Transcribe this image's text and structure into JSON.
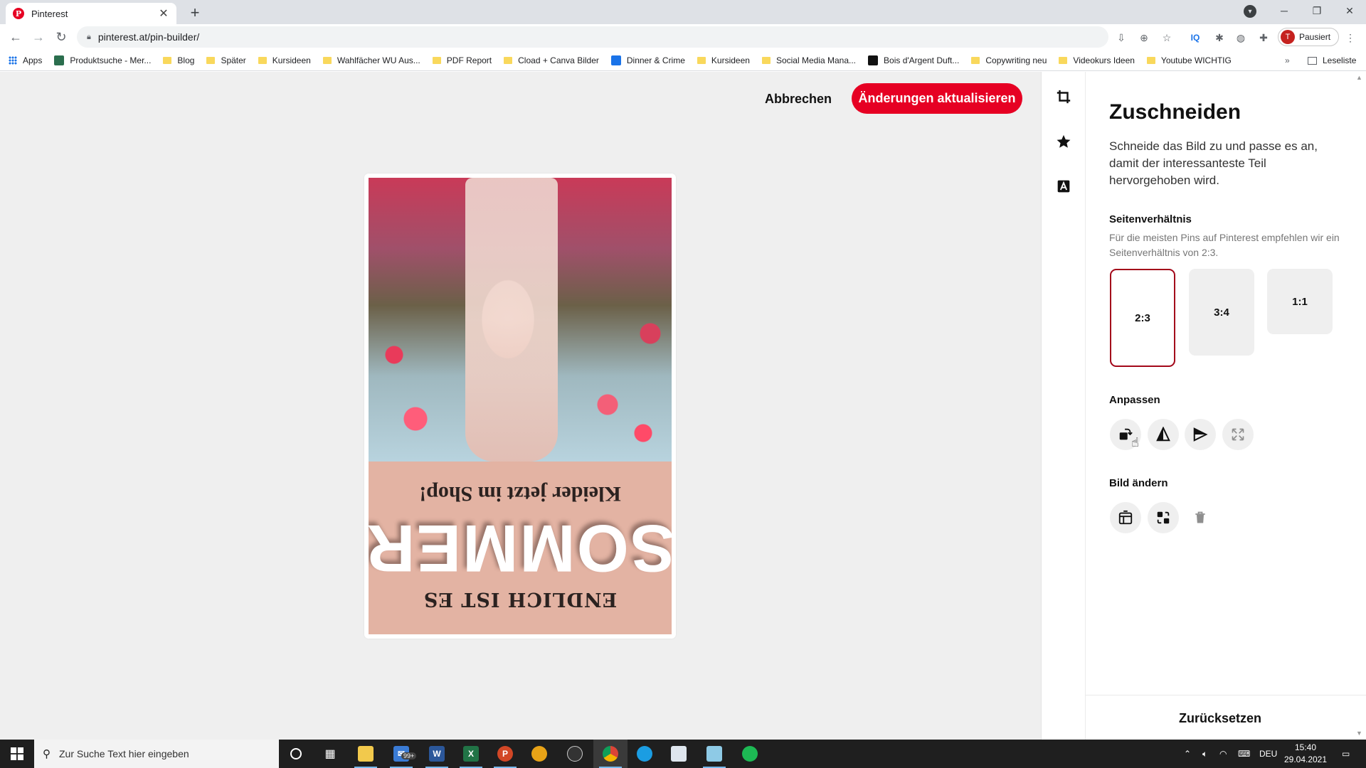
{
  "browser": {
    "tab_title": "Pinterest",
    "tab_favicon": "P",
    "tab_close": "✕",
    "new_tab": "+",
    "url": "pinterest.at/pin-builder/",
    "profile_initial": "T",
    "profile_label": "Pausiert",
    "bookmarks": [
      "Apps",
      "Produktsuche - Mer...",
      "Blog",
      "Später",
      "Kursideen",
      "Wahlfächer WU Aus...",
      "PDF Report",
      "Cload + Canva Bilder",
      "Dinner & Crime",
      "Kursideen",
      "Social Media Mana...",
      "Bois d'Argent Duft...",
      "Copywriting neu",
      "Videokurs Ideen",
      "Youtube WICHTIG"
    ],
    "bookmarks_more": "»",
    "reading_list": "Leseliste",
    "window_controls": [
      "─",
      "❐",
      "✕"
    ]
  },
  "header": {
    "cancel_label": "Abbrechen",
    "update_label": "Änderungen aktualisieren"
  },
  "pin": {
    "line_top": "Kleider jetzt im Shop!",
    "title": "SOMMER",
    "line_bottom": "ENDLICH IST ES"
  },
  "rail": {
    "icons": [
      "crop-icon",
      "star-icon",
      "text-icon"
    ]
  },
  "panel": {
    "title": "Zuschneiden",
    "description": "Schneide das Bild zu und passe es an, damit der interessanteste Teil hervorgehoben wird.",
    "ratio_heading": "Seitenverhältnis",
    "ratio_description": "Für die meisten Pins auf Pinterest empfehlen wir ein Seitenverhältnis von 2:3.",
    "ratios": [
      "2:3",
      "3:4",
      "1:1"
    ],
    "selected_ratio": "2:3",
    "adjust_heading": "Anpassen",
    "adjust_icons": [
      "rotate-icon",
      "flip-vertical-icon",
      "flip-horizontal-icon",
      "expand-icon"
    ],
    "change_heading": "Bild ändern",
    "change_icons": [
      "replace-image-icon",
      "swap-image-icon",
      "trash-icon"
    ],
    "reset_label": "Zurücksetzen"
  },
  "taskbar": {
    "search_placeholder": "Zur Suche Text hier eingeben",
    "mail_badge": "99+",
    "language": "DEU",
    "time": "15:40",
    "date": "29.04.2021"
  },
  "colors": {
    "brand_red": "#e60023",
    "selected_border": "#a3081a",
    "canvas_bg": "#efefef",
    "pin_pink": "#e3b3a3"
  }
}
